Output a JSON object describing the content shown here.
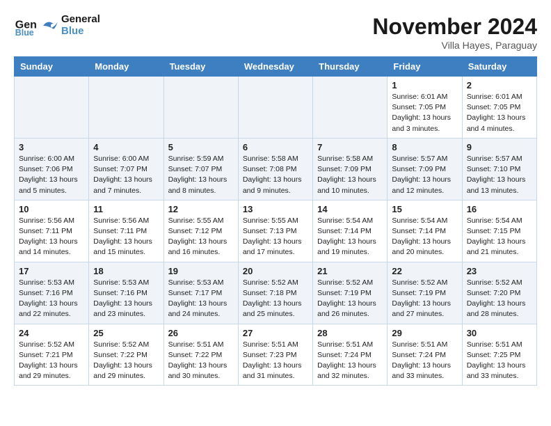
{
  "header": {
    "logo_line1": "General",
    "logo_line2": "Blue",
    "month": "November 2024",
    "location": "Villa Hayes, Paraguay"
  },
  "weekdays": [
    "Sunday",
    "Monday",
    "Tuesday",
    "Wednesday",
    "Thursday",
    "Friday",
    "Saturday"
  ],
  "weeks": [
    [
      {
        "day": "",
        "info": ""
      },
      {
        "day": "",
        "info": ""
      },
      {
        "day": "",
        "info": ""
      },
      {
        "day": "",
        "info": ""
      },
      {
        "day": "",
        "info": ""
      },
      {
        "day": "1",
        "info": "Sunrise: 6:01 AM\nSunset: 7:05 PM\nDaylight: 13 hours\nand 3 minutes."
      },
      {
        "day": "2",
        "info": "Sunrise: 6:01 AM\nSunset: 7:05 PM\nDaylight: 13 hours\nand 4 minutes."
      }
    ],
    [
      {
        "day": "3",
        "info": "Sunrise: 6:00 AM\nSunset: 7:06 PM\nDaylight: 13 hours\nand 5 minutes."
      },
      {
        "day": "4",
        "info": "Sunrise: 6:00 AM\nSunset: 7:07 PM\nDaylight: 13 hours\nand 7 minutes."
      },
      {
        "day": "5",
        "info": "Sunrise: 5:59 AM\nSunset: 7:07 PM\nDaylight: 13 hours\nand 8 minutes."
      },
      {
        "day": "6",
        "info": "Sunrise: 5:58 AM\nSunset: 7:08 PM\nDaylight: 13 hours\nand 9 minutes."
      },
      {
        "day": "7",
        "info": "Sunrise: 5:58 AM\nSunset: 7:09 PM\nDaylight: 13 hours\nand 10 minutes."
      },
      {
        "day": "8",
        "info": "Sunrise: 5:57 AM\nSunset: 7:09 PM\nDaylight: 13 hours\nand 12 minutes."
      },
      {
        "day": "9",
        "info": "Sunrise: 5:57 AM\nSunset: 7:10 PM\nDaylight: 13 hours\nand 13 minutes."
      }
    ],
    [
      {
        "day": "10",
        "info": "Sunrise: 5:56 AM\nSunset: 7:11 PM\nDaylight: 13 hours\nand 14 minutes."
      },
      {
        "day": "11",
        "info": "Sunrise: 5:56 AM\nSunset: 7:11 PM\nDaylight: 13 hours\nand 15 minutes."
      },
      {
        "day": "12",
        "info": "Sunrise: 5:55 AM\nSunset: 7:12 PM\nDaylight: 13 hours\nand 16 minutes."
      },
      {
        "day": "13",
        "info": "Sunrise: 5:55 AM\nSunset: 7:13 PM\nDaylight: 13 hours\nand 17 minutes."
      },
      {
        "day": "14",
        "info": "Sunrise: 5:54 AM\nSunset: 7:14 PM\nDaylight: 13 hours\nand 19 minutes."
      },
      {
        "day": "15",
        "info": "Sunrise: 5:54 AM\nSunset: 7:14 PM\nDaylight: 13 hours\nand 20 minutes."
      },
      {
        "day": "16",
        "info": "Sunrise: 5:54 AM\nSunset: 7:15 PM\nDaylight: 13 hours\nand 21 minutes."
      }
    ],
    [
      {
        "day": "17",
        "info": "Sunrise: 5:53 AM\nSunset: 7:16 PM\nDaylight: 13 hours\nand 22 minutes."
      },
      {
        "day": "18",
        "info": "Sunrise: 5:53 AM\nSunset: 7:16 PM\nDaylight: 13 hours\nand 23 minutes."
      },
      {
        "day": "19",
        "info": "Sunrise: 5:53 AM\nSunset: 7:17 PM\nDaylight: 13 hours\nand 24 minutes."
      },
      {
        "day": "20",
        "info": "Sunrise: 5:52 AM\nSunset: 7:18 PM\nDaylight: 13 hours\nand 25 minutes."
      },
      {
        "day": "21",
        "info": "Sunrise: 5:52 AM\nSunset: 7:19 PM\nDaylight: 13 hours\nand 26 minutes."
      },
      {
        "day": "22",
        "info": "Sunrise: 5:52 AM\nSunset: 7:19 PM\nDaylight: 13 hours\nand 27 minutes."
      },
      {
        "day": "23",
        "info": "Sunrise: 5:52 AM\nSunset: 7:20 PM\nDaylight: 13 hours\nand 28 minutes."
      }
    ],
    [
      {
        "day": "24",
        "info": "Sunrise: 5:52 AM\nSunset: 7:21 PM\nDaylight: 13 hours\nand 29 minutes."
      },
      {
        "day": "25",
        "info": "Sunrise: 5:52 AM\nSunset: 7:22 PM\nDaylight: 13 hours\nand 29 minutes."
      },
      {
        "day": "26",
        "info": "Sunrise: 5:51 AM\nSunset: 7:22 PM\nDaylight: 13 hours\nand 30 minutes."
      },
      {
        "day": "27",
        "info": "Sunrise: 5:51 AM\nSunset: 7:23 PM\nDaylight: 13 hours\nand 31 minutes."
      },
      {
        "day": "28",
        "info": "Sunrise: 5:51 AM\nSunset: 7:24 PM\nDaylight: 13 hours\nand 32 minutes."
      },
      {
        "day": "29",
        "info": "Sunrise: 5:51 AM\nSunset: 7:24 PM\nDaylight: 13 hours\nand 33 minutes."
      },
      {
        "day": "30",
        "info": "Sunrise: 5:51 AM\nSunset: 7:25 PM\nDaylight: 13 hours\nand 33 minutes."
      }
    ]
  ]
}
